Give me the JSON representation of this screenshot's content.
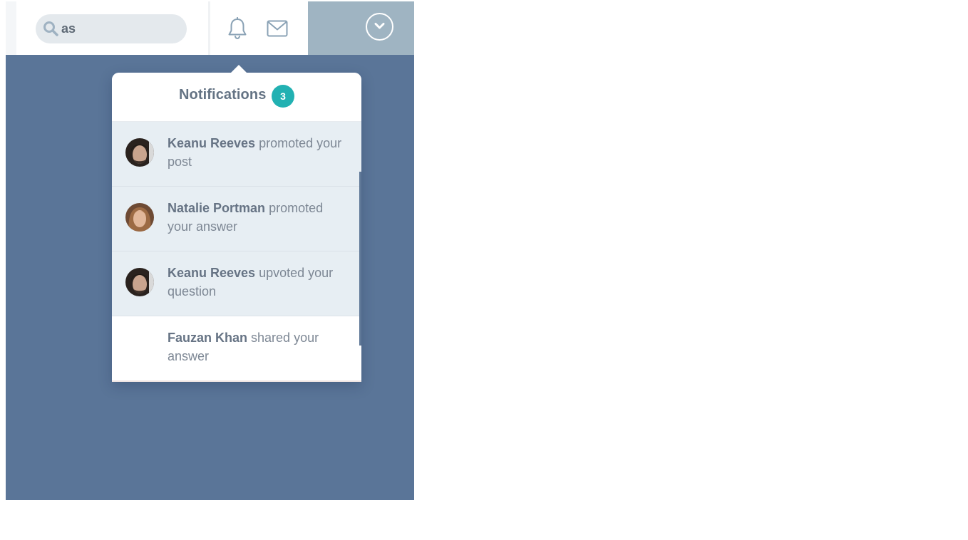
{
  "search": {
    "value": "as",
    "icon": "search-icon"
  },
  "header": {
    "bell_icon": "bell-icon",
    "mail_icon": "mail-icon",
    "user_menu_icon": "chevron-down-icon"
  },
  "notifications": {
    "title": "Notifications",
    "count": "3",
    "items": [
      {
        "name": "Keanu Reeves",
        "action": "promoted your post",
        "read": false,
        "avatar": "avatar-keanu"
      },
      {
        "name": "Natalie Portman",
        "action": "promoted your answer",
        "read": false,
        "avatar": "avatar-natalie"
      },
      {
        "name": "Keanu Reeves",
        "action": "upvoted your question",
        "read": false,
        "avatar": "avatar-keanu"
      },
      {
        "name": "Fauzan Khan",
        "action": "shared your answer",
        "read": true,
        "avatar": ""
      }
    ]
  },
  "colors": {
    "backdrop": "#5a7598",
    "user_area": "#9fb4c2",
    "badge": "#22b1b2",
    "unread_bg": "#e7eef3",
    "search_bg": "#e4e9ed"
  }
}
